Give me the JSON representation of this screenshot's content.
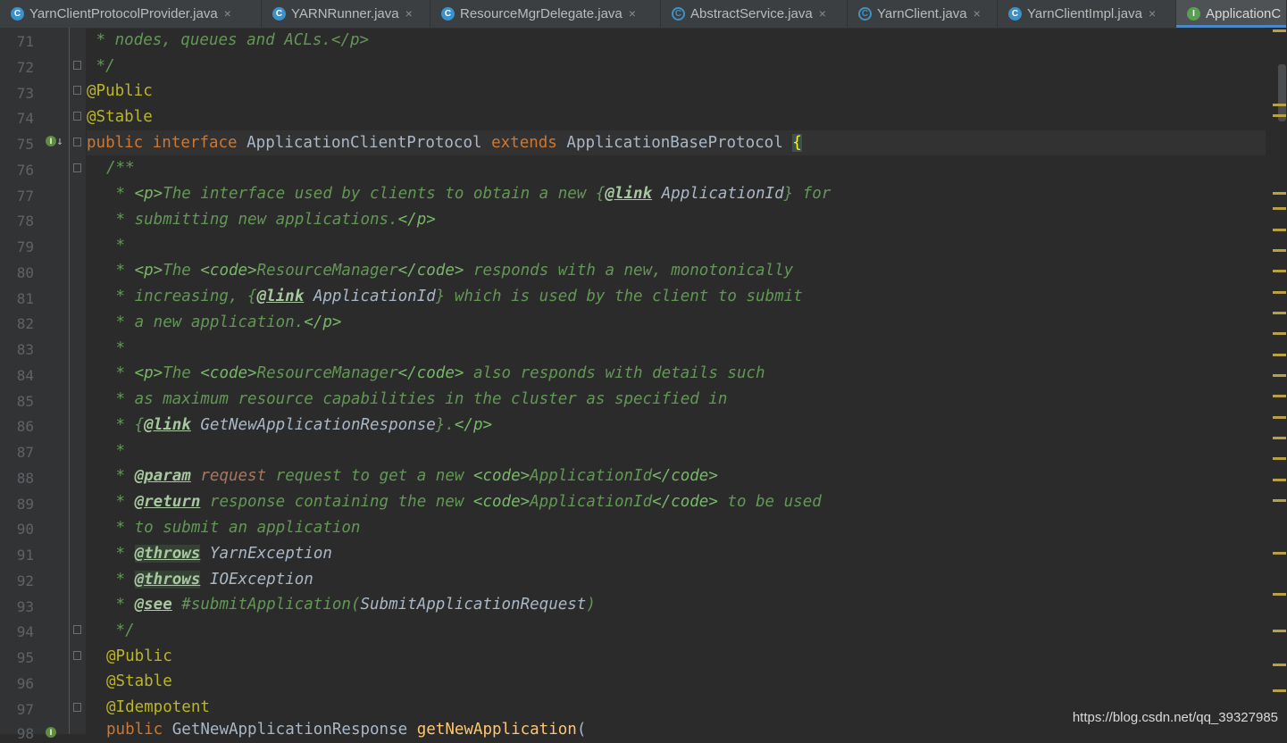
{
  "tabs": [
    {
      "label": "YarnClientProtocolProvider.java",
      "icon": "class-icon",
      "kind": "class"
    },
    {
      "label": "YARNRunner.java",
      "icon": "class-icon",
      "kind": "class"
    },
    {
      "label": "ResourceMgrDelegate.java",
      "icon": "class-icon",
      "kind": "class"
    },
    {
      "label": "AbstractService.java",
      "icon": "abstract-class-icon",
      "kind": "abstract"
    },
    {
      "label": "YarnClient.java",
      "icon": "abstract-class-icon",
      "kind": "abstract"
    },
    {
      "label": "YarnClientImpl.java",
      "icon": "class-icon",
      "kind": "class"
    },
    {
      "label": "ApplicationC",
      "icon": "interface-icon",
      "kind": "interface"
    }
  ],
  "close_glyph": "×",
  "editor": {
    "line_numbers": [
      "71",
      "72",
      "73",
      "74",
      "75",
      "76",
      "77",
      "78",
      "79",
      "80",
      "81",
      "82",
      "83",
      "84",
      "85",
      "86",
      "87",
      "88",
      "89",
      "90",
      "91",
      "92",
      "93",
      "94",
      "95",
      "96",
      "97",
      "98"
    ],
    "t": {
      "l71": " * nodes, queues and ACLs.</p>",
      "l72": " */",
      "l73": "@Public",
      "l74": "@Stable",
      "l75_kw1": "public",
      "l75_kw2": "interface",
      "l75_name": "ApplicationClientProtocol",
      "l75_kw3": "extends",
      "l75_base": "ApplicationBaseProtocol",
      "l75_brace": "{",
      "l76": "/**",
      "l77_a": " * ",
      "l77_tag": "<p>",
      "l77_b": "The interface used by clients to obtain a new {",
      "l77_link": "@link",
      "l77_ref": "ApplicationId",
      "l77_c": "} for",
      "l78_a": " * submitting new applications.",
      "l78_tag": "</p>",
      "l79": " *",
      "l80_a": " * ",
      "l80_tag1": "<p>",
      "l80_b": "The ",
      "l80_tag2": "<code>",
      "l80_c": "ResourceManager",
      "l80_tag3": "</code>",
      "l80_d": " responds with a new, monotonically",
      "l81_a": " * increasing, {",
      "l81_link": "@link",
      "l81_ref": "ApplicationId",
      "l81_b": "} which is used by the client to submit",
      "l82_a": " * a new application.",
      "l82_tag": "</p>",
      "l83": " *",
      "l84_a": " * ",
      "l84_tag1": "<p>",
      "l84_b": "The ",
      "l84_tag2": "<code>",
      "l84_c": "ResourceManager",
      "l84_tag3": "</code>",
      "l84_d": " also responds with details such",
      "l85": " * as maximum resource capabilities in the cluster as specified in",
      "l86_a": " * {",
      "l86_link": "@link",
      "l86_ref": "GetNewApplicationResponse",
      "l86_b": "}.",
      "l86_tag": "</p>",
      "l87": " *",
      "l88_a": " * ",
      "l88_tag": "@param",
      "l88_p": "request",
      "l88_b": " request to get a new ",
      "l88_c1": "<code>",
      "l88_c": "ApplicationId",
      "l88_c2": "</code>",
      "l89_a": " * ",
      "l89_tag": "@return",
      "l89_b": " response containing the new ",
      "l89_c1": "<code>",
      "l89_c": "ApplicationId",
      "l89_c2": "</code>",
      "l89_d": " to be used",
      "l90": " * to submit an application",
      "l91_a": " * ",
      "l91_tag": "@throws",
      "l91_ref": "YarnException",
      "l92_a": " * ",
      "l92_tag": "@throws",
      "l92_ref": "IOException",
      "l93_a": " * ",
      "l93_tag": "@see",
      "l93_b": " #submitApplication(",
      "l93_ref": "SubmitApplicationRequest",
      "l93_c": ")",
      "l94": " */",
      "l95": "@Public",
      "l96": "@Stable",
      "l97": "@Idempotent",
      "l98_kw": "public",
      "l98_type": "GetNewApplicationResponse",
      "l98_fn": "getNewApplication",
      "l98_paren": "("
    }
  },
  "watermark": "https://blog.csdn.net/qq_39327985",
  "colors": {
    "keyword": "#cc7832",
    "annotation": "#bbb529",
    "doc_comment": "#629755",
    "function": "#ffc66d",
    "accent": "#4a88c7"
  }
}
